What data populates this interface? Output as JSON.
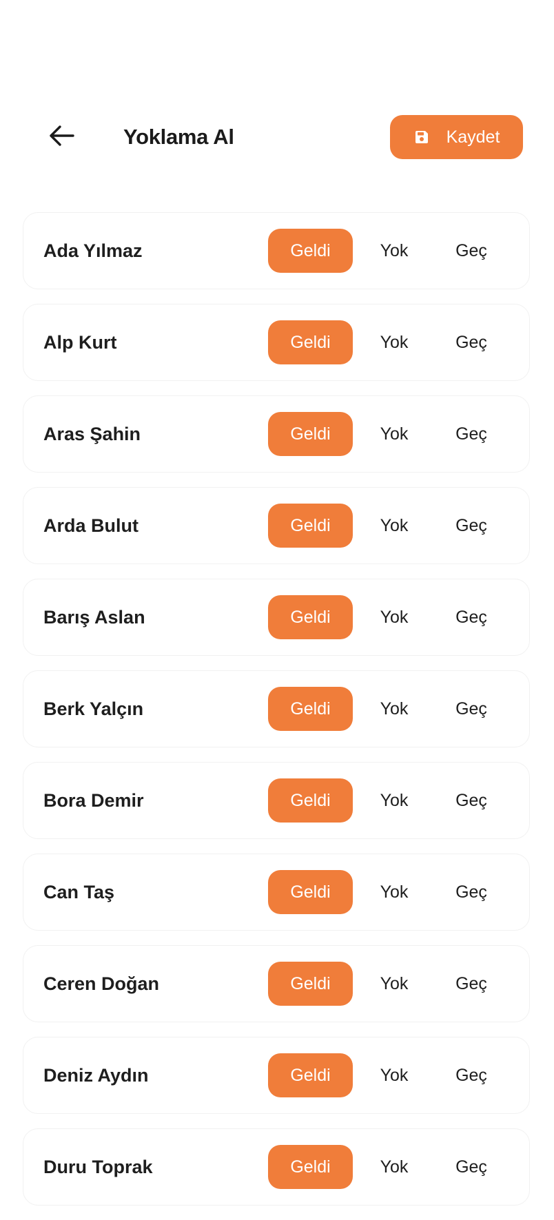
{
  "header": {
    "title": "Yoklama Al",
    "back_icon": "arrow-left-icon",
    "save_label": "Kaydet",
    "save_icon": "floppy-disk-icon"
  },
  "colors": {
    "accent": "#f07d3a",
    "text": "#1b1b1b",
    "row_border": "#f1f1f1"
  },
  "options": {
    "present": "Geldi",
    "absent": "Yok",
    "late": "Geç"
  },
  "students": [
    {
      "name": "Ada Yılmaz",
      "status": "Geldi"
    },
    {
      "name": "Alp Kurt",
      "status": "Geldi"
    },
    {
      "name": "Aras Şahin",
      "status": "Geldi"
    },
    {
      "name": "Arda Bulut",
      "status": "Geldi"
    },
    {
      "name": "Barış Aslan",
      "status": "Geldi"
    },
    {
      "name": "Berk Yalçın",
      "status": "Geldi"
    },
    {
      "name": "Bora Demir",
      "status": "Geldi"
    },
    {
      "name": "Can Taş",
      "status": "Geldi"
    },
    {
      "name": "Ceren Doğan",
      "status": "Geldi"
    },
    {
      "name": "Deniz Aydın",
      "status": "Geldi"
    },
    {
      "name": "Duru Toprak",
      "status": "Geldi"
    }
  ]
}
